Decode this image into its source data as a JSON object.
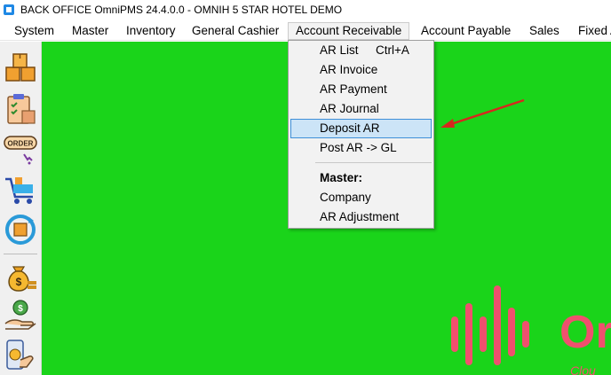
{
  "window": {
    "title": "BACK OFFICE OmniPMS 24.4.0.0 - OMNIH 5 STAR HOTEL DEMO"
  },
  "menubar": {
    "items": [
      {
        "label": "System"
      },
      {
        "label": "Master"
      },
      {
        "label": "Inventory"
      },
      {
        "label": "General Cashier"
      },
      {
        "label": "Account Receivable"
      },
      {
        "label": "Account Payable"
      },
      {
        "label": "Sales"
      },
      {
        "label": "Fixed A"
      }
    ],
    "active_item": "Account Receivable"
  },
  "ar_menu": {
    "items": [
      {
        "label": "AR List",
        "shortcut": "Ctrl+A"
      },
      {
        "label": "AR Invoice"
      },
      {
        "label": "AR Payment"
      },
      {
        "label": "AR Journal"
      },
      {
        "label": "Deposit AR"
      },
      {
        "label": "Post AR -> GL"
      }
    ],
    "master_header": "Master:",
    "master_items": [
      {
        "label": "Company"
      },
      {
        "label": "AR Adjustment"
      }
    ],
    "highlighted_item": "Deposit AR"
  },
  "toolbar": {
    "icons": [
      "boxes-icon",
      "clipboard-checklist-icon",
      "order-icon",
      "shopping-cart-icon",
      "refresh-box-icon",
      "money-bag-icon",
      "hand-money-icon",
      "mobile-payment-icon"
    ],
    "order_badge": "ORDER"
  },
  "workspace": {
    "background_color": "#1ad41a",
    "logo_text": "Or",
    "logo_subtext": "Clou"
  },
  "colors": {
    "highlight": "#cce4f7",
    "highlight_border": "#3e8fd8",
    "arrow": "#d6281e",
    "logo": "#f0506e"
  }
}
